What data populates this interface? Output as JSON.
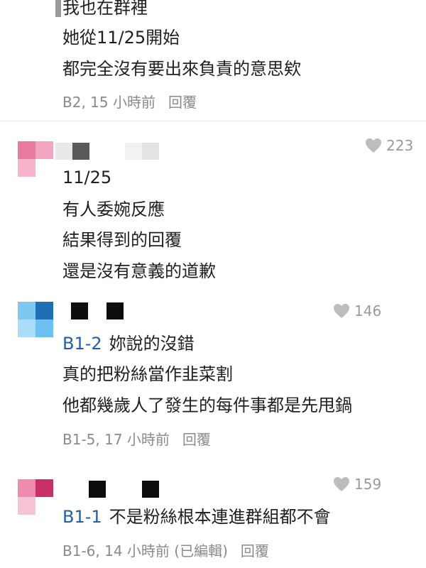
{
  "comment_b2": {
    "lines": [
      "我也在群裡",
      "她從11/25開始",
      "都完全沒有要出來負責的意思欸"
    ],
    "meta": "B2, 15 小時前",
    "reply_label": "回覆"
  },
  "comment_b1": {
    "likes": "223",
    "lines": [
      "11/25",
      "有人委婉反應",
      "結果得到的回覆",
      "還是沒有意義的道歉"
    ],
    "avatar_colors": [
      "#e77a9e",
      "#f3a6c1",
      "#f6b5cd",
      "#ffffff"
    ],
    "name_blocks": [
      "#e9e9e9",
      "#5a5a5a",
      "#f2f2f2",
      "#e3e3e3"
    ]
  },
  "comment_b1_5": {
    "likes": "146",
    "mention": "B1-2",
    "lines": [
      "妳說的沒錯",
      "真的把粉絲當作韭菜割",
      "他都幾歲人了發生的每件事都是先甩鍋"
    ],
    "meta": "B1-5, 17 小時前",
    "reply_label": "回覆",
    "avatar_colors": [
      "#7ec8f0",
      "#1f6fb7",
      "#a8dcf7",
      "#6cc1f0"
    ],
    "name_blocks": [
      "#0d0d0d",
      "#0d0d0d"
    ]
  },
  "comment_b1_6": {
    "likes": "159",
    "mention": "B1-1",
    "text": "不是粉絲根本連進群組都不會",
    "meta": "B1-6, 14 小時前 (已編輯)",
    "reply_label": "回覆",
    "avatar_colors": [
      "#f08bb0",
      "#c9306a",
      "#f7c4d7",
      "#ffffff"
    ],
    "name_blocks": [
      "#0d0d0d",
      "#0d0d0d"
    ]
  },
  "colors": {
    "mention": "#1f5fa8",
    "meta_gray": "#8a8a8a",
    "divider": "#e6e6e6"
  },
  "icons": [
    "heart-icon"
  ]
}
